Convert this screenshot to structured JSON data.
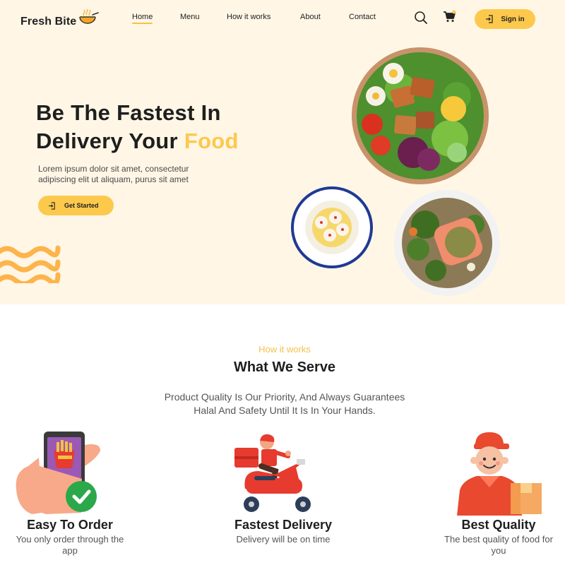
{
  "brand": {
    "name": "Fresh Bite",
    "logo_icon": "steaming-bowl-icon"
  },
  "nav": {
    "items": [
      {
        "label": "Home",
        "active": true
      },
      {
        "label": "Menu",
        "active": false
      },
      {
        "label": "How it works",
        "active": false
      },
      {
        "label": "About",
        "active": false
      },
      {
        "label": "Contact",
        "active": false
      }
    ],
    "search_icon": "search-icon",
    "cart_icon": "cart-icon",
    "signin_label": "Sign in"
  },
  "hero": {
    "title_line1": "Be The Fastest In",
    "title_line2_main": "Delivery Your ",
    "title_line2_accent": "Food",
    "subtitle": "Lorem ipsum dolor sit amet, consectetur adipiscing elit ut aliquam, purus sit amet",
    "cta_label": "Get Started"
  },
  "how_it_works": {
    "eyebrow": "How it works",
    "title": "What We Serve",
    "subtitle_line1": "Product Quality Is Our Priority, And Always Guarantees",
    "subtitle_line2": "Halal And Safety Until It Is In Your Hands.",
    "features": [
      {
        "title": "Easy To Order",
        "desc": "You only order through the app",
        "icon": "phone-order-icon"
      },
      {
        "title": "Fastest Delivery",
        "desc": "Delivery will be on time",
        "icon": "scooter-delivery-icon"
      },
      {
        "title": "Best Quality",
        "desc": "The best quality of food for you",
        "icon": "delivery-man-icon"
      }
    ]
  },
  "colors": {
    "accent": "#fcc94d",
    "hero_bg": "#fff6e6",
    "eyebrow": "#f4c14c"
  }
}
